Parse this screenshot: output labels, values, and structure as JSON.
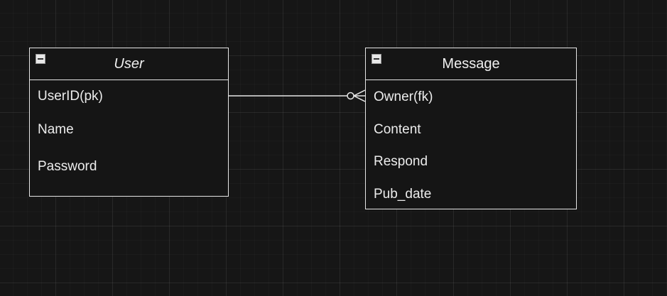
{
  "entities": {
    "user": {
      "title": "User",
      "attributes": [
        "UserID(pk)",
        "Name",
        "Password"
      ]
    },
    "message": {
      "title": "Message",
      "attributes": [
        "Owner(fk)",
        "Content",
        "Respond",
        "Pub_date"
      ]
    }
  },
  "relationship": {
    "from": "UserID(pk)",
    "to": "Owner(fk)",
    "notation": "one-to-zero-or-many"
  },
  "colors": {
    "background": "#161616",
    "stroke": "#e6e6e6",
    "text": "#f0f0f0"
  }
}
